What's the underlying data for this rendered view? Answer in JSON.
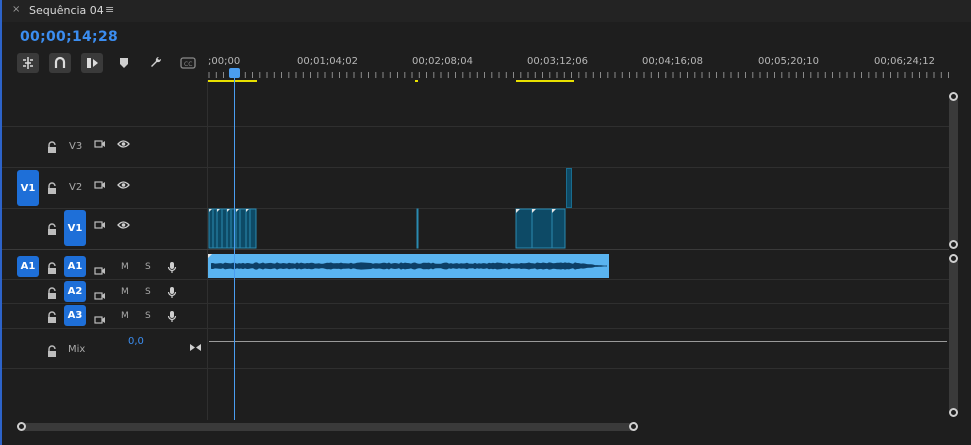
{
  "tab": {
    "close": "×",
    "title": "Sequência 04",
    "menu": "≡"
  },
  "timecode": "00;00;14;28",
  "toolbar": {
    "tools": [
      "snap-insert-icon",
      "magnet-icon",
      "linked-selection-icon",
      "marker-icon",
      "wrench-icon",
      "captions-icon"
    ]
  },
  "ruler": {
    "labels": [
      ";00;00",
      "00;01;04;02",
      "00;02;08;04",
      "00;03;12;06",
      "00;04;16;08",
      "00;05;20;10",
      "00;06;24;12"
    ]
  },
  "tracks": {
    "video": [
      {
        "name": "V3",
        "source": ""
      },
      {
        "name": "V2",
        "source": "V1"
      },
      {
        "name": "V1",
        "source": ""
      }
    ],
    "audio": [
      {
        "name": "A1",
        "source": "A1",
        "m": "M",
        "s": "S"
      },
      {
        "name": "A2",
        "source": "",
        "m": "M",
        "s": "S"
      },
      {
        "name": "A3",
        "source": "",
        "m": "M",
        "s": "S"
      }
    ],
    "mix": {
      "label": "Mix",
      "value": "0,0"
    }
  },
  "colors": {
    "accent": "#1e6fd8",
    "timecode": "#3b8df0",
    "video_clip": "#0d4a66",
    "audio_clip": "#5ab4f0",
    "work_area": "#e8e000"
  }
}
